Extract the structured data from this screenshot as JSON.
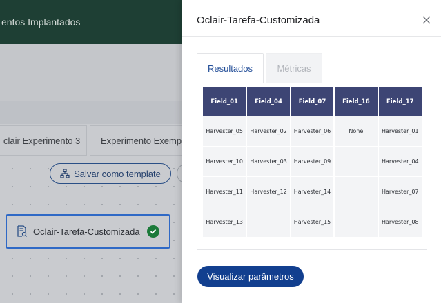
{
  "background": {
    "header_text": "entos Implantados",
    "tabs": [
      "clair Experimento 3",
      "Experimento Exempl"
    ],
    "save_template_label": "Salvar como template",
    "task_node_label": "Oclair-Tarefa-Customizada"
  },
  "panel": {
    "title": "Oclair-Tarefa-Customizada",
    "tabs": [
      {
        "label": "Resultados",
        "active": true
      },
      {
        "label": "Métricas",
        "active": false
      }
    ],
    "table": {
      "columns": [
        "Field_01",
        "Field_04",
        "Field_07",
        "Field_16",
        "Field_17"
      ],
      "rows": [
        [
          "Harvester_05",
          "Harvester_02",
          "Harvester_06",
          "None",
          "Harvester_01"
        ],
        [
          "Harvester_10",
          "Harvester_03",
          "Harvester_09",
          "",
          "Harvester_04"
        ],
        [
          "Harvester_11",
          "Harvester_12",
          "Harvester_14",
          "",
          "Harvester_07"
        ],
        [
          "Harvester_13",
          "",
          "Harvester_15",
          "",
          "Harvester_08"
        ]
      ]
    },
    "primary_button_label": "Visualizar parâmetros"
  },
  "colors": {
    "accent": "#123f8f",
    "table_header": "#3d4574",
    "success": "#1b7a3a",
    "app_header": "#1e3f34"
  }
}
